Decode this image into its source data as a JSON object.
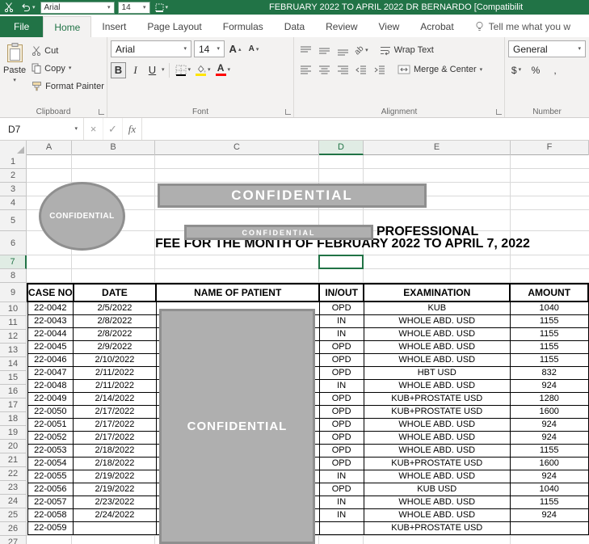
{
  "icons": {
    "dropdown": "▾",
    "triangle_up": "▴",
    "triangle_down": "▾",
    "cancel": "×",
    "enter": "✓",
    "fx": "fx"
  },
  "colors": {
    "excel_green": "#217346",
    "shape_fill": "#AFAFAF",
    "shape_border": "#8F8F8F",
    "fill_color_swatch": "#FFE400",
    "font_color_swatch": "#FF0000"
  },
  "title_bar": {
    "qat_font": "Arial",
    "qat_size": "14",
    "title": "FEBRUARY 2022 TO APRIL 2022  DR BERNARDO  [Compatibilit"
  },
  "ribbon": {
    "tabs": [
      "File",
      "Home",
      "Insert",
      "Page Layout",
      "Formulas",
      "Data",
      "Review",
      "View",
      "Acrobat"
    ],
    "tell_me": "Tell me what you w",
    "clipboard": {
      "label": "Clipboard",
      "paste": "Paste",
      "cut": "Cut",
      "copy": "Copy",
      "format_painter": "Format Painter"
    },
    "font": {
      "label": "Font",
      "family": "Arial",
      "size": "14",
      "bold": "B",
      "italic": "I",
      "underline": "U"
    },
    "alignment": {
      "label": "Alignment",
      "wrap_text": "Wrap Text",
      "merge_center": "Merge & Center"
    },
    "number": {
      "label": "Number",
      "format": "General",
      "currency": "$",
      "percent": "%",
      "comma": ","
    }
  },
  "formula_bar": {
    "name_box": "D7",
    "formula": ""
  },
  "sheet": {
    "columns": [
      "A",
      "B",
      "C",
      "D",
      "E",
      "F"
    ],
    "active_cell": "D7",
    "shapes": {
      "ellipse_text": "CONFIDENTIAL",
      "banner_text": "CONFIDENTIAL",
      "small_banner_text": "CONFIDENTIAL",
      "patient_cover_text": "CONFIDENTIAL"
    },
    "heading": {
      "professional": "PROFESSIONAL",
      "fee_line": "FEE FOR THE MONTH OF FEBRUARY 2022 TO APRIL 7, 2022"
    },
    "table": {
      "headers": [
        "CASE NO",
        "DATE",
        "NAME OF PATIENT",
        "IN/OUT",
        "EXAMINATION",
        "AMOUNT"
      ],
      "rows": [
        [
          "22-0042",
          "2/5/2022",
          "",
          "OPD",
          "KUB",
          "1040"
        ],
        [
          "22-0043",
          "2/8/2022",
          "",
          "IN",
          "WHOLE ABD. USD",
          "1155"
        ],
        [
          "22-0044",
          "2/8/2022",
          "",
          "IN",
          "WHOLE ABD. USD",
          "1155"
        ],
        [
          "22-0045",
          "2/9/2022",
          "",
          "OPD",
          "WHOLE ABD. USD",
          "1155"
        ],
        [
          "22-0046",
          "2/10/2022",
          "",
          "OPD",
          "WHOLE ABD. USD",
          "1155"
        ],
        [
          "22-0047",
          "2/11/2022",
          "",
          "OPD",
          "HBT USD",
          "832"
        ],
        [
          "22-0048",
          "2/11/2022",
          "",
          "IN",
          "WHOLE ABD. USD",
          "924"
        ],
        [
          "22-0049",
          "2/14/2022",
          "",
          "OPD",
          "KUB+PROSTATE USD",
          "1280"
        ],
        [
          "22-0050",
          "2/17/2022",
          "",
          "OPD",
          "KUB+PROSTATE USD",
          "1600"
        ],
        [
          "22-0051",
          "2/17/2022",
          "",
          "OPD",
          "WHOLE ABD. USD",
          "924"
        ],
        [
          "22-0052",
          "2/17/2022",
          "",
          "OPD",
          "WHOLE ABD. USD",
          "924"
        ],
        [
          "22-0053",
          "2/18/2022",
          "",
          "OPD",
          "WHOLE ABD. USD",
          "1155"
        ],
        [
          "22-0054",
          "2/18/2022",
          "",
          "OPD",
          "KUB+PROSTATE USD",
          "1600"
        ],
        [
          "22-0055",
          "2/19/2022",
          "",
          "IN",
          "WHOLE ABD. USD",
          "924"
        ],
        [
          "22-0056",
          "2/19/2022",
          "",
          "OPD",
          "KUB USD",
          "1040"
        ],
        [
          "22-0057",
          "2/23/2022",
          "",
          "IN",
          "WHOLE ABD. USD",
          "1155"
        ],
        [
          "22-0058",
          "2/24/2022",
          "",
          "IN",
          "WHOLE ABD. USD",
          "924"
        ]
      ],
      "partial_row": [
        "22-0059",
        "",
        "",
        "",
        "KUB+PROSTATE USD",
        ""
      ]
    }
  }
}
